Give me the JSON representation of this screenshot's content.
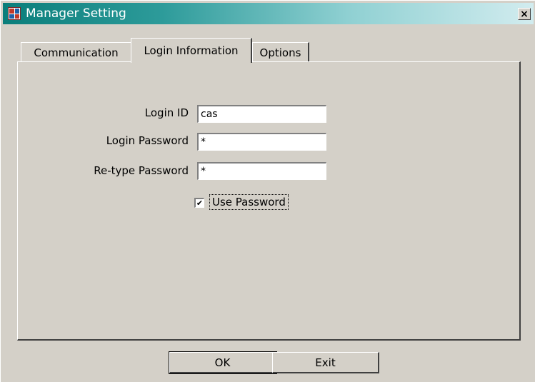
{
  "window": {
    "title": "Manager Setting",
    "icon": "app-icon",
    "close_label": "×"
  },
  "tabs": [
    {
      "label": "Communication",
      "selected": false
    },
    {
      "label": "Login Information",
      "selected": true
    },
    {
      "label": "Options",
      "selected": false
    }
  ],
  "form": {
    "login_id_label": "Login ID",
    "login_id_value": "cas",
    "login_password_label": "Login Password",
    "login_password_value": "*",
    "retype_password_label": "Re-type Password",
    "retype_password_value": "*",
    "use_password_label": "Use Password",
    "use_password_checked": true,
    "check_mark": "✔"
  },
  "buttons": {
    "ok_label": "OK",
    "exit_label": "Exit"
  },
  "colors": {
    "titlebar_start": "#0a7e7b",
    "titlebar_end": "#d2ecef",
    "face": "#d4d0c8"
  }
}
